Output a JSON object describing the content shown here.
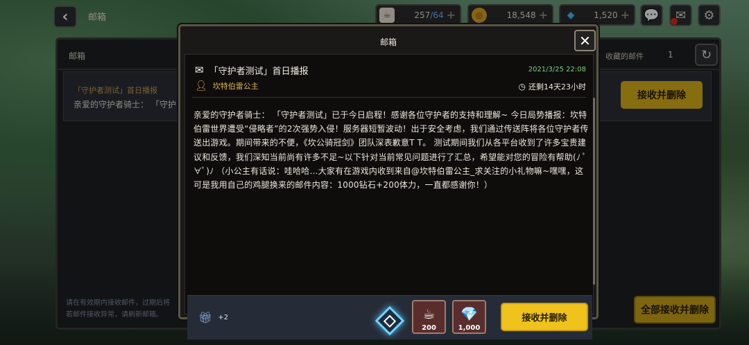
{
  "topbar": {
    "title": "邮箱",
    "stamina": {
      "current": "257",
      "max": "/64",
      "icon": "coffee-cup-icon"
    },
    "coins": {
      "value": "18,548",
      "icon": "gold-coin-icon"
    },
    "gems": {
      "value": "1,520",
      "icon": "blue-gem-icon"
    },
    "plus": "+"
  },
  "mailbox": {
    "title": "邮箱",
    "favorites_label": "收藏的邮件",
    "favorites_count": "1",
    "item": {
      "title": "「守护者测试」首日播报",
      "preview": "亲爱的守护者骑士：  「守护"
    },
    "accept_delete": "接收并删除",
    "note_line1": "请在有效期内接收邮件，过期后将",
    "note_line2": "若邮件接收异常，请刷新邮箱。",
    "accept_all": "全部接收并删除"
  },
  "modal": {
    "title": "邮箱",
    "close": "✕",
    "subject": "「守护者测试」首日播报",
    "sender": "坎特伯雷公主",
    "date": "2021/3/25 22:08",
    "remaining": "还剩14天23小时",
    "body": "亲爱的守护者骑士：  「守护者测试」已于今日启程！感谢各位守护者的支持和理解~ 今日局势播报：坎特伯雷世界遭受“侵略者”的2次强势入侵！服务器短暂波动！出于安全考虑，我们通过传送阵将各位守护者传送出游戏。期间带来的不便，《坎公骑冠剑》团队深表歉意T T。 测试期间我们从各平台收到了许多宝贵建议和反馈，我们深知当前尚有许多不足~以下针对当前常见问题进行了汇总，希望能对您的冒险有帮助(ﾉ ﾟ∀ﾟ)ﾉ （小公主有话说：哇哈哈…大家有在游戏内收到来自@坎特伯雷公主_求关注的小礼物嘛~嘿嘿，这可是我用自己的鸡腿换来的邮件内容：1000钻石+200体力，一直都感谢你！）",
    "gift_extra": "+2",
    "rewards": [
      {
        "icon": "coffee-cup-icon",
        "glyph": "☕",
        "count": "200"
      },
      {
        "icon": "blue-gem-icon",
        "glyph": "💎",
        "count": "1,000"
      }
    ],
    "accept_delete": "接收并删除"
  },
  "colors": {
    "accent_yellow": "#f0c31c",
    "sender_gold": "#e0b454",
    "date_green": "#7fd27a"
  }
}
